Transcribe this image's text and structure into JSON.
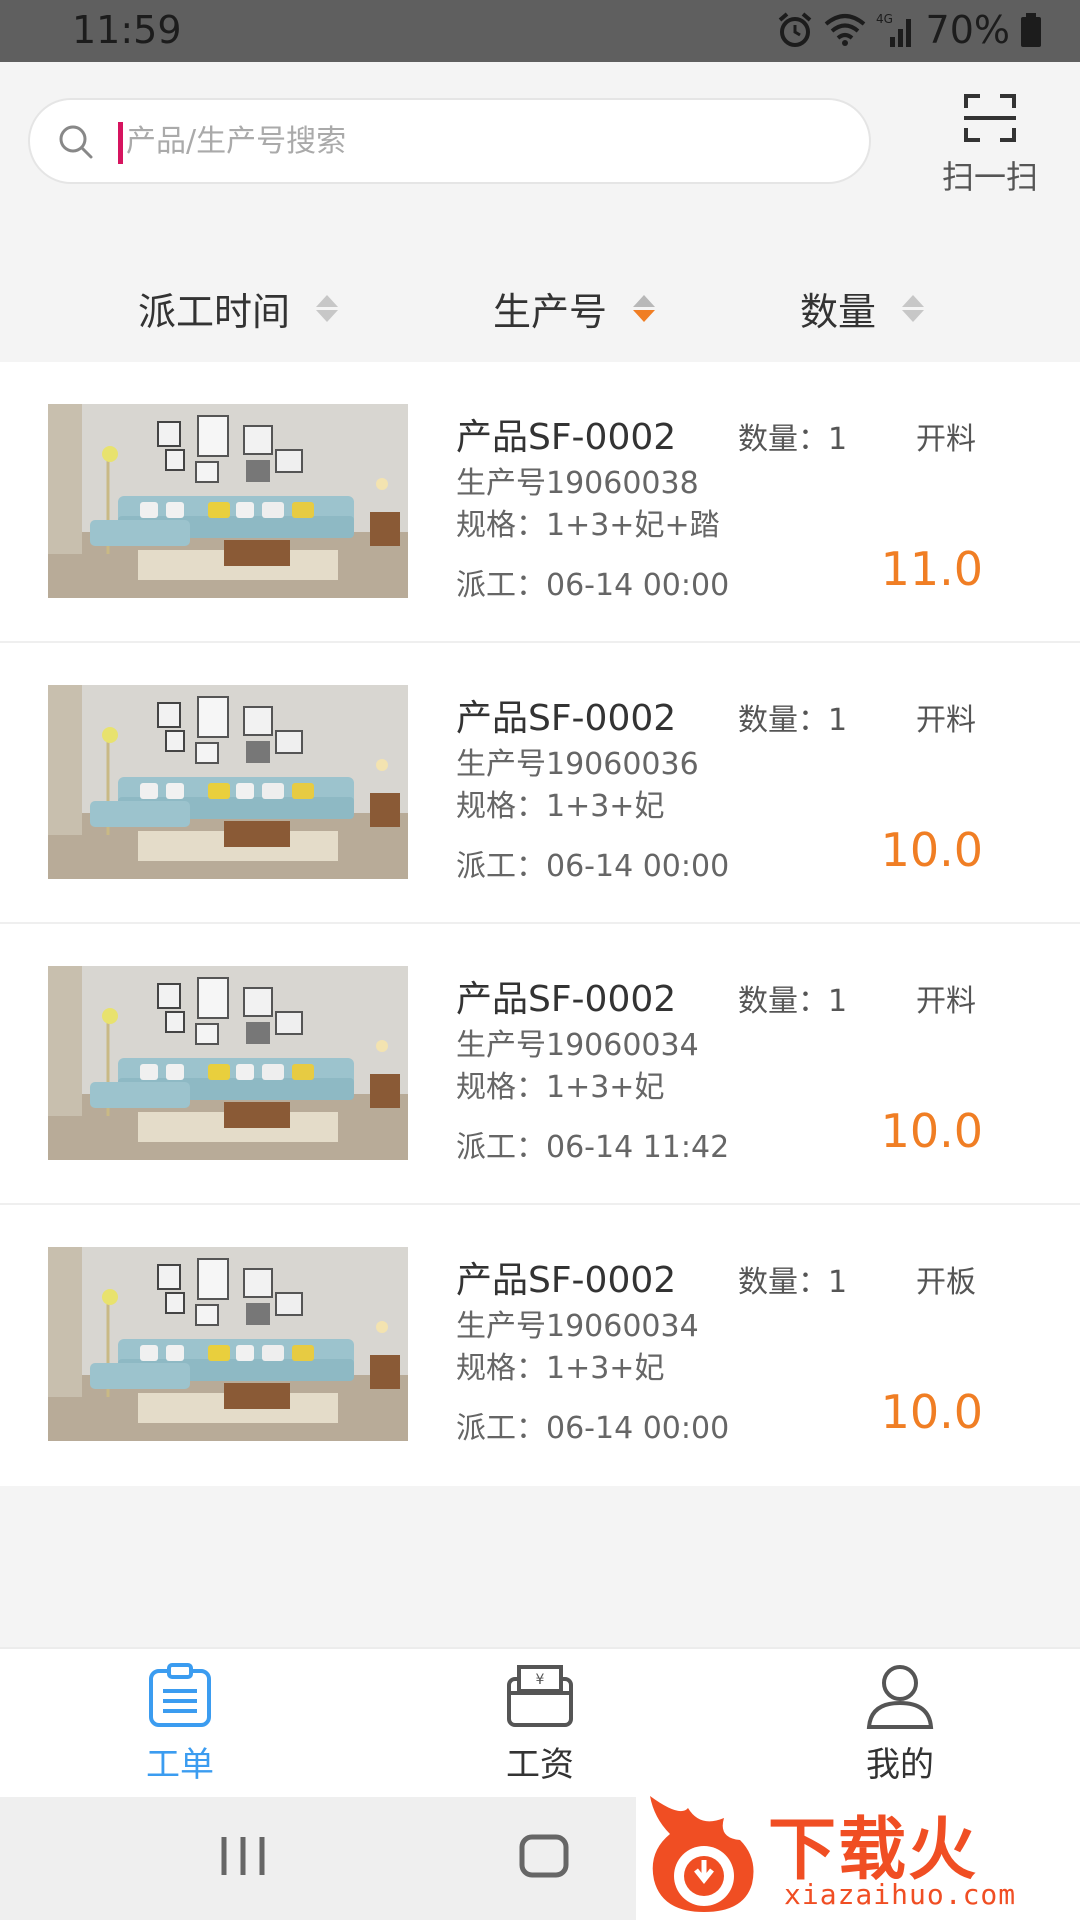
{
  "status_bar": {
    "time": "11:59",
    "battery": "70%",
    "network": "4G"
  },
  "search": {
    "placeholder": "产品/生产号搜索",
    "value": ""
  },
  "scan": {
    "label": "扫一扫",
    "icon": "scan-icon"
  },
  "sort_bar": {
    "items": [
      {
        "label": "派工时间",
        "active": false
      },
      {
        "label": "生产号",
        "active": true
      },
      {
        "label": "数量",
        "active": false
      }
    ]
  },
  "orders": [
    {
      "product": "产品SF-0002",
      "quantity": "数量：1",
      "process": "开料",
      "production_no": "生产号19060038",
      "spec": "规格：1+3+妃+踏",
      "dispatch": "派工：06-14 00:00",
      "price": "11.0"
    },
    {
      "product": "产品SF-0002",
      "quantity": "数量：1",
      "process": "开料",
      "production_no": "生产号19060036",
      "spec": "规格：1+3+妃",
      "dispatch": "派工：06-14 00:00",
      "price": "10.0"
    },
    {
      "product": "产品SF-0002",
      "quantity": "数量：1",
      "process": "开料",
      "production_no": "生产号19060034",
      "spec": "规格：1+3+妃",
      "dispatch": "派工：06-14 11:42",
      "price": "10.0"
    },
    {
      "product": "产品SF-0002",
      "quantity": "数量：1",
      "process": "开板",
      "production_no": "生产号19060034",
      "spec": "规格：1+3+妃",
      "dispatch": "派工：06-14 00:00",
      "price": "10.0"
    }
  ],
  "bottom_nav": {
    "items": [
      {
        "label": "工单",
        "icon": "clipboard-icon",
        "active": true
      },
      {
        "label": "工资",
        "icon": "wallet-icon",
        "active": false
      },
      {
        "label": "我的",
        "icon": "user-icon",
        "active": false
      }
    ]
  },
  "watermark": {
    "title": "下载火",
    "url": "xiazaihuo.com"
  },
  "colors": {
    "accent_orange": "#f07e24",
    "active_blue": "#3b9cf0",
    "cursor": "#d6145f"
  }
}
